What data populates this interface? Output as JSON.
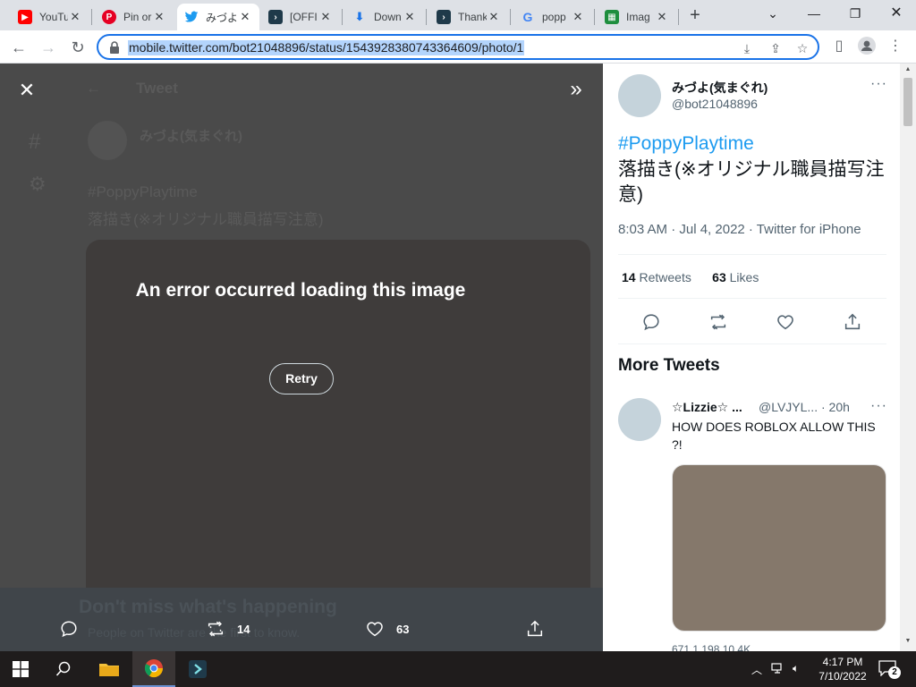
{
  "browser": {
    "tabs": [
      {
        "title": "YouTu",
        "favicon": "youtube-icon",
        "color": "#ff0000"
      },
      {
        "title": "Pin or",
        "favicon": "pinterest-icon",
        "color": "#e60023"
      },
      {
        "title": "みづよ",
        "favicon": "twitter-icon",
        "color": "#1d9bf0"
      },
      {
        "title": "[OFFI",
        "favicon": "app-icon",
        "color": "#1f3a4a"
      },
      {
        "title": "Down",
        "favicon": "download-icon",
        "color": "#1a73e8"
      },
      {
        "title": "Thank",
        "favicon": "app-icon",
        "color": "#1f3a4a"
      },
      {
        "title": "popp",
        "favicon": "google-icon",
        "color": "#4285f4"
      },
      {
        "title": "Imag",
        "favicon": "image-icon",
        "color": "#1e8e3e"
      }
    ],
    "url": "mobile.twitter.com/bot21048896/status/1543928380743364609/photo/1"
  },
  "viewer": {
    "ghost_tweet_label": "Tweet",
    "ghost_name": "みづよ(気まぐれ)",
    "ghost_hashtag": "#PoppyPlaytime",
    "ghost_text": "落描き(※オリジナル職員描写注意)",
    "error_message": "An error occurred loading this image",
    "retry_label": "Retry",
    "banner_ghost": "Don't miss what's happening",
    "banner_ghost_sub": "People on Twitter are the first to know.",
    "retweet_count": "14",
    "like_count": "63"
  },
  "tweet": {
    "author_name": "みづよ(気まぐれ)",
    "author_handle": "@bot21048896",
    "hashtag": "#PoppyPlaytime",
    "text": "落描き(※オリジナル職員描写注意)",
    "timestamp": "8:03 AM · Jul 4, 2022 · Twitter for iPhone",
    "retweets": "14",
    "retweets_label": "Retweets",
    "likes": "63",
    "likes_label": "Likes"
  },
  "more_tweets": {
    "title": "More Tweets",
    "item": {
      "author_name": "☆Lizzie☆ ...",
      "handle_time": "@LVJYL... · 20h",
      "text": "HOW DOES ROBLOX ALLOW THIS ?!",
      "stats": "671     1,198     10.4K"
    }
  },
  "taskbar": {
    "time": "4:17 PM",
    "date": "7/10/2022",
    "notifications": "2"
  }
}
